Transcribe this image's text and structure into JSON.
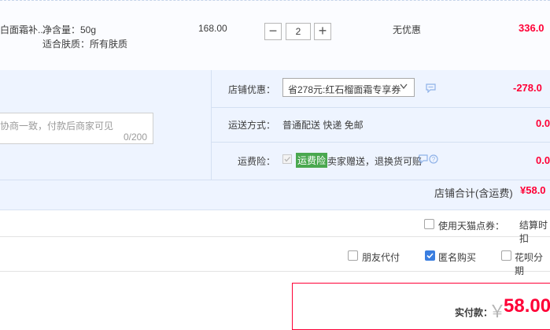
{
  "product": {
    "name_fragment": "白面霜补...",
    "spec_net_label": "净含量：50g",
    "spec_skin_label": "适合肤质：所有肤质",
    "unit_price": "168.00",
    "quantity": "2",
    "qty_minus": "−",
    "qty_plus": "+",
    "discount": "无优惠",
    "subtotal": "336.0"
  },
  "message": {
    "placeholder": "协商一致，付款后商家可见",
    "counter": "0/200"
  },
  "shop": {
    "coupon_label": "店铺优惠：",
    "coupon_value": "省278元:红石榴面霜专享券",
    "coupon_amount": "-278.0",
    "shipping_label": "运送方式：",
    "shipping_value": "普通配送 快递 免邮",
    "shipping_amount": "0.0",
    "insurance_label": "运费险：",
    "insurance_badge": "运费险",
    "insurance_text": "卖家赠送，退换货可赔",
    "insurance_amount": "0.0",
    "total_label": "店铺合计(含运费)",
    "total_value": "¥58.0"
  },
  "points": {
    "label": "使用天猫点券：",
    "settle_text": "结算时扣"
  },
  "options": {
    "friend_pay": "朋友代付",
    "anonymous": "匿名购买",
    "huabei": "花呗分期"
  },
  "payment": {
    "label": "实付款：",
    "currency": "￥",
    "amount": "58.00"
  },
  "colors": {
    "accent_red": "#ff0036",
    "checkbox_blue": "#3a7ee0",
    "insurance_green": "#4aa84f"
  }
}
